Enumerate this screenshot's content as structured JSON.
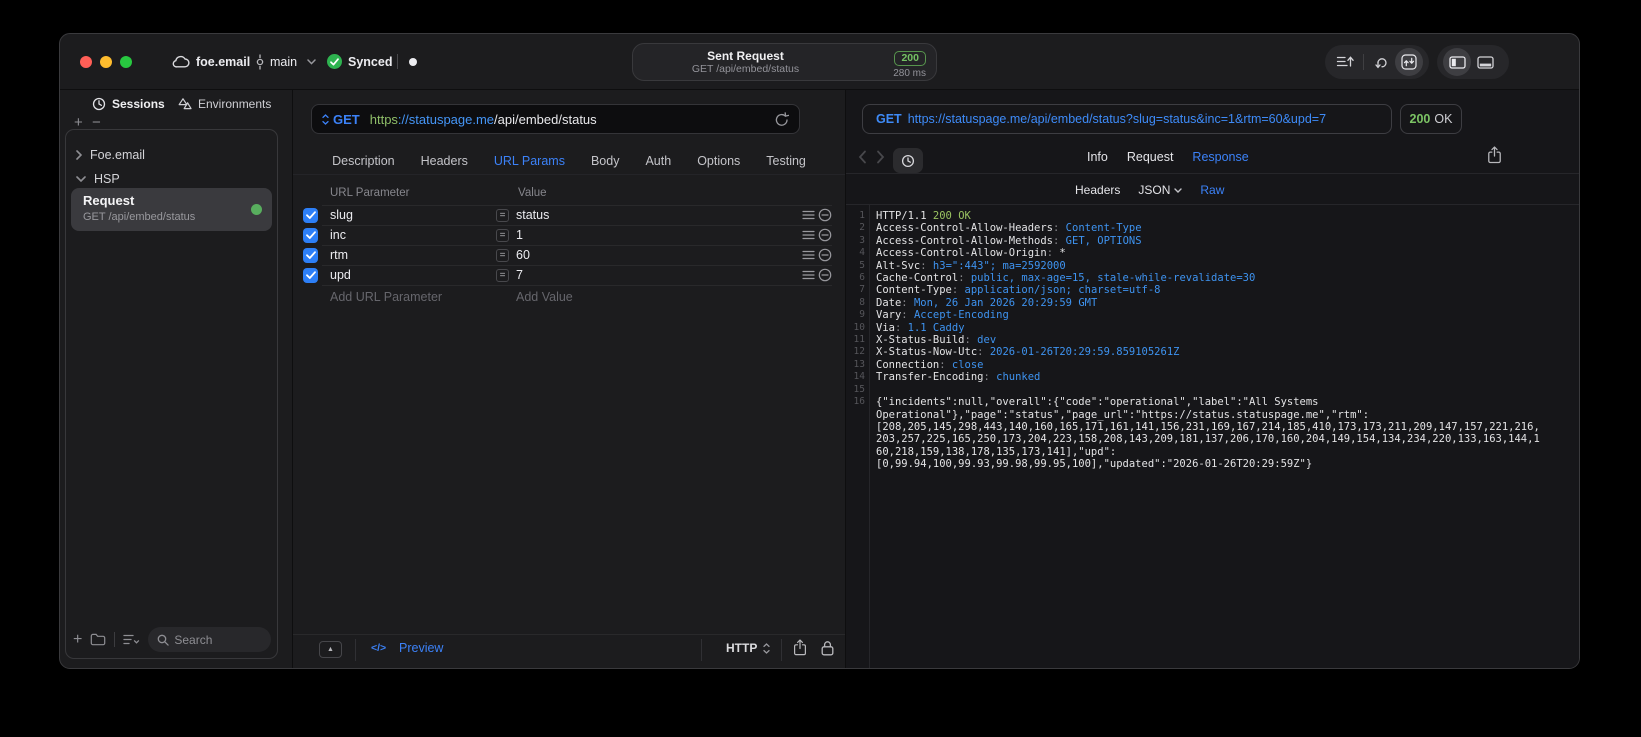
{
  "titlebar": {
    "project": "foe.email",
    "branch": "main",
    "sync_label": "Synced",
    "request_summary": {
      "title": "Sent Request",
      "subtitle": "GET /api/embed/status",
      "status_code": "200",
      "duration": "280 ms"
    }
  },
  "sidebar": {
    "tabs": [
      {
        "label": "Sessions"
      },
      {
        "label": "Environments"
      }
    ],
    "tree": [
      {
        "label": "Foe.email"
      },
      {
        "label": "HSP"
      }
    ],
    "request_item": {
      "title": "Request",
      "subtitle": "GET /api/embed/status"
    },
    "search_placeholder": "Search"
  },
  "request_pane": {
    "method": "GET",
    "url": {
      "scheme": "https",
      "host": "://statuspage.me",
      "path": "/api/embed/status"
    },
    "tabs": [
      "Description",
      "Headers",
      "URL Params",
      "Body",
      "Auth",
      "Options",
      "Testing"
    ],
    "active_tab": "URL Params",
    "params_table": {
      "col_param": "URL Parameter",
      "col_value": "Value",
      "rows": [
        {
          "name": "slug",
          "value": "status",
          "enabled": true
        },
        {
          "name": "inc",
          "value": "1",
          "enabled": true
        },
        {
          "name": "rtm",
          "value": "60",
          "enabled": true
        },
        {
          "name": "upd",
          "value": "7",
          "enabled": true
        }
      ],
      "add_param_label": "Add URL Parameter",
      "add_value_label": "Add Value"
    },
    "footer": {
      "code_glyph": "</>",
      "preview_label": "Preview",
      "protocol": "HTTP"
    }
  },
  "response_pane": {
    "method": "GET",
    "url": "https://statuspage.me/api/embed/status?slug=status&inc=1&rtm=60&upd=7",
    "status_code": "200",
    "status_text": "OK",
    "tabs": [
      "Info",
      "Request",
      "Response"
    ],
    "active_tab": "Response",
    "view_tabs": [
      "Headers",
      "JSON",
      "Raw"
    ],
    "active_view": "Raw",
    "raw_lines": [
      {
        "n": "1",
        "seg": [
          [
            "HTTP/1.1 ",
            "p"
          ],
          [
            "200 OK",
            "g"
          ]
        ]
      },
      {
        "n": "2",
        "seg": [
          [
            "Access-Control-Allow-Headers",
            "p"
          ],
          [
            ": ",
            "d"
          ],
          [
            "Content-Type",
            "b"
          ]
        ]
      },
      {
        "n": "3",
        "seg": [
          [
            "Access-Control-Allow-Methods",
            "p"
          ],
          [
            ": ",
            "d"
          ],
          [
            "GET, OPTIONS",
            "b"
          ]
        ]
      },
      {
        "n": "4",
        "seg": [
          [
            "Access-Control-Allow-Origin",
            "p"
          ],
          [
            ": ",
            "d"
          ],
          [
            "*",
            "p"
          ]
        ]
      },
      {
        "n": "5",
        "seg": [
          [
            "Alt-Svc",
            "p"
          ],
          [
            ": ",
            "d"
          ],
          [
            "h3=\":443\"; ma=2592000",
            "b"
          ]
        ]
      },
      {
        "n": "6",
        "seg": [
          [
            "Cache-Control",
            "p"
          ],
          [
            ": ",
            "d"
          ],
          [
            "public, max-age=15, stale-while-revalidate=30",
            "b"
          ]
        ]
      },
      {
        "n": "7",
        "seg": [
          [
            "Content-Type",
            "p"
          ],
          [
            ": ",
            "d"
          ],
          [
            "application/json; charset=utf-8",
            "b"
          ]
        ]
      },
      {
        "n": "8",
        "seg": [
          [
            "Date",
            "p"
          ],
          [
            ": ",
            "d"
          ],
          [
            "Mon, 26 Jan 2026 20:29:59 GMT",
            "b"
          ]
        ]
      },
      {
        "n": "9",
        "seg": [
          [
            "Vary",
            "p"
          ],
          [
            ": ",
            "d"
          ],
          [
            "Accept-Encoding",
            "b"
          ]
        ]
      },
      {
        "n": "10",
        "seg": [
          [
            "Via",
            "p"
          ],
          [
            ": ",
            "d"
          ],
          [
            "1.1 Caddy",
            "b"
          ]
        ]
      },
      {
        "n": "11",
        "seg": [
          [
            "X-Status-Build",
            "p"
          ],
          [
            ": ",
            "d"
          ],
          [
            "dev",
            "b"
          ]
        ]
      },
      {
        "n": "12",
        "seg": [
          [
            "X-Status-Now-Utc",
            "p"
          ],
          [
            ": ",
            "d"
          ],
          [
            "2026-01-26T20:29:59.859105261Z",
            "b"
          ]
        ]
      },
      {
        "n": "13",
        "seg": [
          [
            "Connection",
            "p"
          ],
          [
            ": ",
            "d"
          ],
          [
            "close",
            "b"
          ]
        ]
      },
      {
        "n": "14",
        "seg": [
          [
            "Transfer-Encoding",
            "p"
          ],
          [
            ": ",
            "d"
          ],
          [
            "chunked",
            "b"
          ]
        ]
      },
      {
        "n": "15",
        "seg": []
      },
      {
        "n": "16",
        "seg": [
          [
            "{\"incidents\":null,\"overall\":{\"code\":\"operational\",\"label\":\"All Systems",
            "p"
          ]
        ]
      },
      {
        "n": "",
        "seg": [
          [
            "Operational\"},\"page\":\"status\",\"page_url\":\"https://status.statuspage.me\",\"rtm\":",
            "p"
          ]
        ]
      },
      {
        "n": "",
        "seg": [
          [
            "[208,205,145,298,443,140,160,165,171,161,141,156,231,169,167,214,185,410,173,173,211,209,147,157,221,216,",
            "p"
          ]
        ]
      },
      {
        "n": "",
        "seg": [
          [
            "203,257,225,165,250,173,204,223,158,208,143,209,181,137,206,170,160,204,149,154,134,234,220,133,163,144,1",
            "p"
          ]
        ]
      },
      {
        "n": "",
        "seg": [
          [
            "60,218,159,138,178,135,173,141],\"upd\":",
            "p"
          ]
        ]
      },
      {
        "n": "",
        "seg": [
          [
            "[0,99.94,100,99.93,99.98,99.95,100],\"updated\":\"2026-01-26T20:29:59Z\"}",
            "p"
          ]
        ]
      }
    ]
  }
}
